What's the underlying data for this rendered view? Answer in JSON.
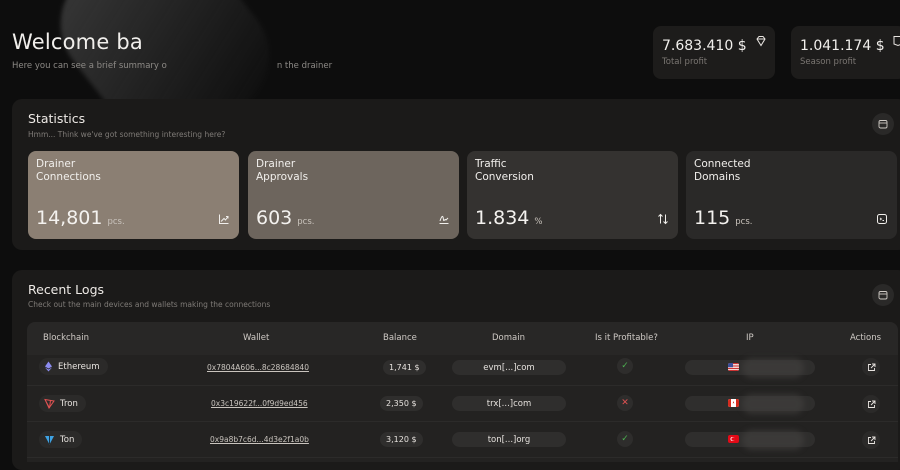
{
  "header": {
    "title": "Welcome ba",
    "subtitle_start": "Here you can see a brief summary o",
    "subtitle_end": "n the drainer"
  },
  "profit_cards": [
    {
      "value": "7.683.410 $",
      "label": "Total profit",
      "icon": "diamond-icon"
    },
    {
      "value": "1.041.174 $",
      "label": "Season profit",
      "icon": "badge-icon"
    }
  ],
  "statistics": {
    "title": "Statistics",
    "subtitle": "Hmm... Think we've got something interesting here?",
    "cards": [
      {
        "title": "Drainer\nConnections",
        "value": "14,801",
        "unit": "pcs.",
        "icon": "chart-up-icon",
        "bg": "#8b7f73"
      },
      {
        "title": "Drainer\nApprovals",
        "value": "603",
        "unit": "pcs.",
        "icon": "signature-icon",
        "bg": "#6d655d"
      },
      {
        "title": "Traffic\nConversion",
        "value": "1.834",
        "unit": "%",
        "icon": "sort-arrows-icon",
        "bg": "#343230"
      },
      {
        "title": "Connected\nDomains",
        "value": "115",
        "unit": "pcs.",
        "icon": "browser-icon",
        "bg": "#2a2928"
      }
    ]
  },
  "logs": {
    "title": "Recent Logs",
    "subtitle": "Check out the main devices and wallets making the connections",
    "columns": [
      "Blockchain",
      "Wallet",
      "Balance",
      "Domain",
      "Is it Profitable?",
      "IP",
      "Actions"
    ],
    "rows": [
      {
        "chain": "Ethereum",
        "chain_icon": "ethereum-icon",
        "wallet": "0x7804A606...8c28684840",
        "balance": "1,741 $",
        "domain": "evm[...]com",
        "profitable": true,
        "flag": "us"
      },
      {
        "chain": "Tron",
        "chain_icon": "tron-icon",
        "wallet": "0x3c19622f...0f9d9ed456",
        "balance": "2,350 $",
        "domain": "trx[...]com",
        "profitable": false,
        "flag": "ca"
      },
      {
        "chain": "Ton",
        "chain_icon": "ton-icon",
        "wallet": "0x9a8b7c6d...4d3e2f1a0b",
        "balance": "3,120 $",
        "domain": "ton[...]org",
        "profitable": true,
        "flag": "tr"
      }
    ]
  },
  "colors": {
    "accent_green": "#4caf50",
    "accent_red": "#e05252",
    "background": "#0d0d0d",
    "panel": "#1b1a19"
  }
}
